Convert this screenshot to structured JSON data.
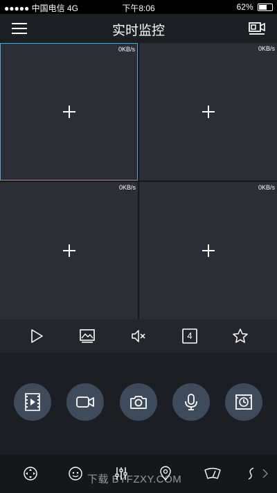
{
  "status_bar": {
    "carrier": "●●●●● 中国电信  4G",
    "time": "下午8:06",
    "battery": "62%",
    "battery_level": 0.62
  },
  "header": {
    "title": "实时监控"
  },
  "grid": {
    "cells": [
      {
        "rate": "0KB/s",
        "selected": true
      },
      {
        "rate": "0KB/s",
        "selected": false
      },
      {
        "rate": "0KB/s",
        "selected": false
      },
      {
        "rate": "0KB/s",
        "selected": false
      }
    ]
  },
  "toolbar": {
    "icons": [
      "play-icon",
      "image-quality-icon",
      "mute-icon",
      "split-screen-icon",
      "favorite-star-icon"
    ],
    "split_count": "4"
  },
  "controls": {
    "buttons": [
      "record-video-icon",
      "video-camera-icon",
      "snapshot-camera-icon",
      "microphone-icon",
      "playback-icon"
    ]
  },
  "bottom_bar": {
    "icons": [
      "ptz-direction-icon",
      "face-icon",
      "adjust-sliders-icon",
      "location-icon",
      "wiper-icon",
      "more-icon"
    ],
    "watermark": "下载 BYFZXY.COM"
  },
  "colors": {
    "background": "#1b1e23",
    "cell": "#2b2e35",
    "selected_border": "#5aa7c4",
    "round_button": "#3e4b5b"
  }
}
